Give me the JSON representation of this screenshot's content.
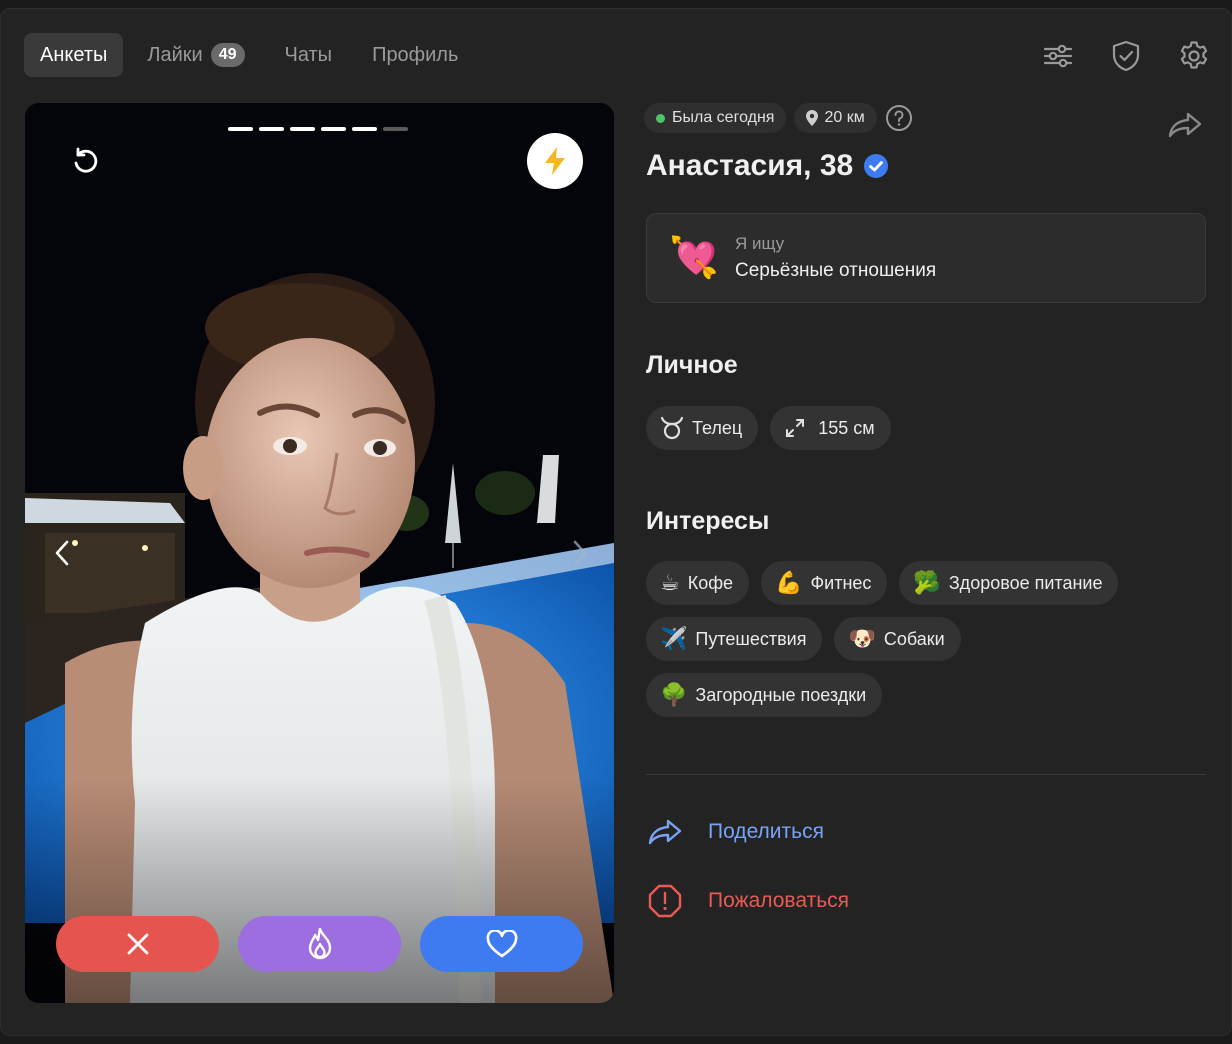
{
  "nav": {
    "tabs": [
      {
        "label": "Анкеты"
      },
      {
        "label": "Лайки",
        "badge": "49"
      },
      {
        "label": "Чаты"
      },
      {
        "label": "Профиль"
      }
    ],
    "icons": [
      "filters-icon",
      "shield-check-icon",
      "gear-icon"
    ]
  },
  "photo": {
    "progress_total": 6,
    "progress_seen": 5,
    "colors": {
      "dislike": "#e5544f",
      "superlike": "#9d6ee0",
      "like": "#3f7bf0"
    }
  },
  "profile": {
    "status": "Была сегодня",
    "distance": "20 км",
    "name": "Анастасия, 38",
    "verified": true,
    "looking_label": "Я ищу",
    "looking_value": "Серьёзные отношения",
    "looking_emoji": "💘"
  },
  "personal": {
    "title": "Личное",
    "items": [
      {
        "icon": "taurus-icon",
        "label": "Телец"
      },
      {
        "icon": "height-icon",
        "label": "155 см"
      }
    ]
  },
  "interests": {
    "title": "Интересы",
    "items": [
      {
        "emoji": "☕",
        "label": "Кофе"
      },
      {
        "emoji": "💪",
        "label": "Фитнес"
      },
      {
        "emoji": "🥦",
        "label": "Здоровое питание"
      },
      {
        "emoji": "✈️",
        "label": "Путешествия"
      },
      {
        "emoji": "🐶",
        "label": "Собаки"
      },
      {
        "emoji": "🌳",
        "label": "Загородные поездки"
      }
    ]
  },
  "links": {
    "share": "Поделиться",
    "report": "Пожаловаться"
  }
}
